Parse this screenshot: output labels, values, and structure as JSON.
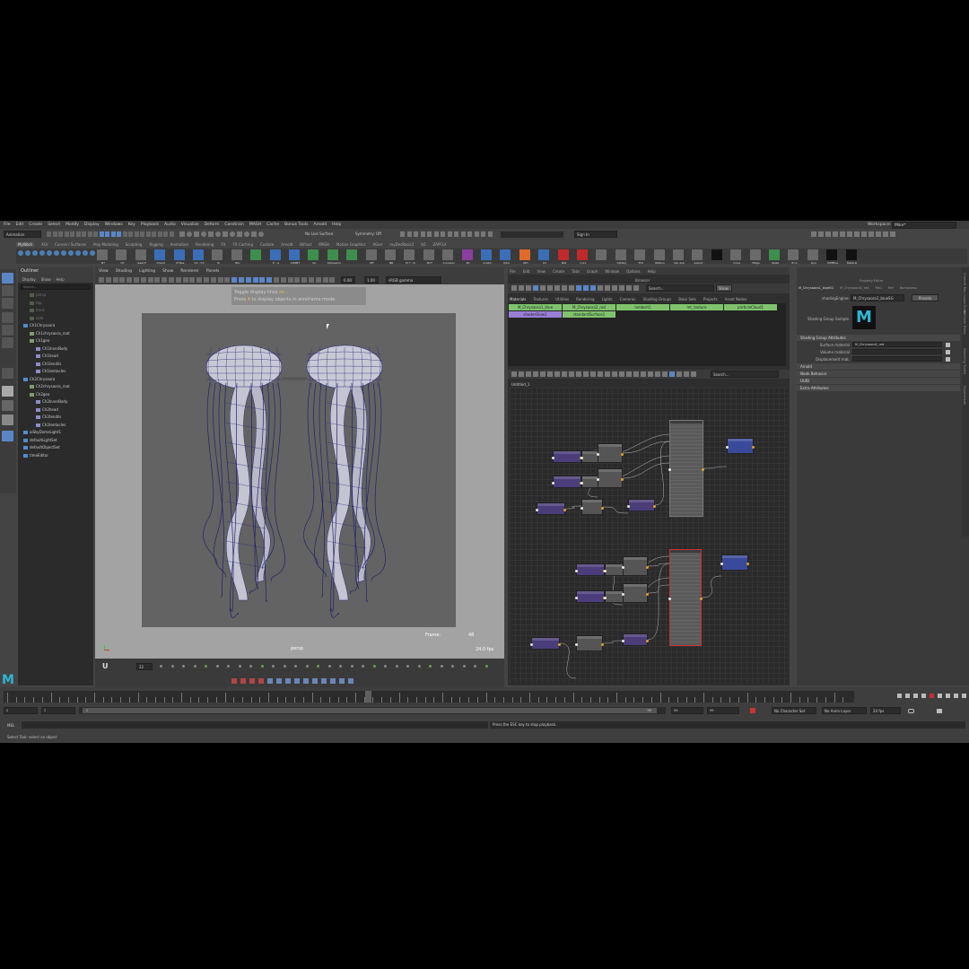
{
  "menu": {
    "items": [
      "File",
      "Edit",
      "Create",
      "Select",
      "Modify",
      "Display",
      "Windows",
      "Key",
      "Playback",
      "Audio",
      "Visualize",
      "Deform",
      "Constrain",
      "MASH",
      "Cache",
      "Bonus Tools",
      "Arnold",
      "Help"
    ],
    "workspace_label": "Workspace:",
    "workspace_value": "Mike*"
  },
  "status": {
    "mode": "Animation",
    "live_surface": "No Live Surface",
    "symmetry": "Symmetry: Off",
    "sign_in": "Sign In"
  },
  "shelf": {
    "tabs": [
      "MyWork",
      "XGI",
      "Curves / Surfaces",
      "Poly Modeling",
      "Sculpting",
      "Rigging",
      "Animation",
      "Rendering",
      "FX",
      "FX Caching",
      "Custom",
      "Arnold",
      "Bifrost",
      "MASH",
      "Motion Graphics",
      "XGen",
      "myDecBasic2",
      "b5",
      "ZAPFLX"
    ],
    "icons": [
      {
        "label": "B7",
        "color": "#6a6a6a"
      },
      {
        "label": "CP",
        "color": "#6a6a6a"
      },
      {
        "label": "reset P",
        "color": "#6a6a6a"
      },
      {
        "label": "Orient",
        "color": "#3a6fb8"
      },
      {
        "label": "CTRLa",
        "color": "#3a6fb8"
      },
      {
        "label": "CV - CV",
        "color": "#3a6fb8"
      },
      {
        "label": "IS",
        "color": "#6a6a6a"
      },
      {
        "label": "RSc",
        "color": "#6a6a6a"
      },
      {
        "label": "",
        "color": "#3e8e4e"
      },
      {
        "label": "P - A",
        "color": "#3a6fb8"
      },
      {
        "label": "CON87",
        "color": "#3a6fb8"
      },
      {
        "label": "bn",
        "color": "#3e8e4e"
      },
      {
        "label": "Sphreams",
        "color": "#3e8e4e"
      },
      {
        "label": "",
        "color": "#3e8e4e"
      },
      {
        "label": "MT",
        "color": "#6a6a6a"
      },
      {
        "label": "NR",
        "color": "#6a6a6a"
      },
      {
        "label": "M T - R",
        "color": "#6a6a6a"
      },
      {
        "label": "MoT",
        "color": "#6a6a6a"
      },
      {
        "label": "CurveLiv",
        "color": "#6a6a6a"
      },
      {
        "label": "2D",
        "color": "#8a3fa0"
      },
      {
        "label": "Graph",
        "color": "#3a6fb8"
      },
      {
        "label": "Qdsl",
        "color": "#3a6fb8"
      },
      {
        "label": "Oth",
        "color": "#e06a2a"
      },
      {
        "label": "bd",
        "color": "#3a6fb8"
      },
      {
        "label": "Bat",
        "color": "#c02a2a"
      },
      {
        "label": "Curv",
        "color": "#c02a2a"
      },
      {
        "label": "",
        "color": "#6a6a6a"
      },
      {
        "label": "CR/Key",
        "color": "#6a6a6a"
      },
      {
        "label": "fmt",
        "color": "#6a6a6a"
      },
      {
        "label": "Ribbon",
        "color": "#6a6a6a"
      },
      {
        "label": "tex dup",
        "color": "#6a6a6a"
      },
      {
        "label": "export",
        "color": "#6a6a6a"
      },
      {
        "label": "",
        "color": "#111111"
      },
      {
        "label": "Cone",
        "color": "#6a6a6a"
      },
      {
        "label": "Mage",
        "color": "#6a6a6a"
      },
      {
        "label": "Spike",
        "color": "#3e8e4e"
      },
      {
        "label": "B rd",
        "color": "#6a6a6a"
      },
      {
        "label": "Dyn",
        "color": "#6a6a6a"
      },
      {
        "label": "OVERLA",
        "color": "#111111"
      },
      {
        "label": "Materal",
        "color": "#111111"
      }
    ]
  },
  "outliner": {
    "title": "Outliner",
    "menu": [
      "Display",
      "Show",
      "Help"
    ],
    "search_placeholder": "Search...",
    "items": [
      {
        "indent": 1,
        "label": "persp",
        "dim": true
      },
      {
        "indent": 1,
        "label": "top",
        "dim": true
      },
      {
        "indent": 1,
        "label": "front",
        "dim": true
      },
      {
        "indent": 1,
        "label": "side",
        "dim": true
      },
      {
        "indent": 0,
        "label": "Ch1Chrysaora",
        "dim": false
      },
      {
        "indent": 1,
        "label": "Ch1chrysaora_root",
        "dim": false
      },
      {
        "indent": 1,
        "label": "Ch1geo",
        "dim": false
      },
      {
        "indent": 2,
        "label": "Ch1InnerBody",
        "dim": false
      },
      {
        "indent": 2,
        "label": "Ch1head",
        "dim": false
      },
      {
        "indent": 2,
        "label": "Ch1tendils",
        "dim": false
      },
      {
        "indent": 2,
        "label": "Ch1tentacles",
        "dim": false
      },
      {
        "indent": 0,
        "label": "Ch2Chrysaora",
        "dim": false
      },
      {
        "indent": 1,
        "label": "Ch2chrysaora_root",
        "dim": false
      },
      {
        "indent": 1,
        "label": "Ch2geo",
        "dim": false
      },
      {
        "indent": 2,
        "label": "Ch2InnerBody",
        "dim": false
      },
      {
        "indent": 2,
        "label": "Ch2head",
        "dim": false
      },
      {
        "indent": 2,
        "label": "Ch2tendils",
        "dim": false
      },
      {
        "indent": 2,
        "label": "Ch2tentacles",
        "dim": false
      },
      {
        "indent": 0,
        "label": "aiSkyDomeLight1",
        "dim": false
      },
      {
        "indent": 0,
        "label": "defaultLightSet",
        "dim": false
      },
      {
        "indent": 0,
        "label": "defaultObjectSet",
        "dim": false
      },
      {
        "indent": 0,
        "label": "timeEditor",
        "dim": false
      }
    ]
  },
  "viewport": {
    "menu": [
      "View",
      "Shading",
      "Lighting",
      "Show",
      "Renderer",
      "Panels"
    ],
    "hud_line1_pre": "Toggle display lines ",
    "hud_line1_on": "on",
    "hud_line1_post": " .",
    "hud_line2_pre": "Press ",
    "hud_line2_key": "4",
    "hud_line2_post": " to display objects in wireframe mode.",
    "value_a": "0.00",
    "value_b": "1.00",
    "colorspace": "sRGB gamma",
    "frame_label": "Frame:",
    "frame_value": "48",
    "camera": "persp",
    "fps": "24.0 fps"
  },
  "playback": {
    "current_frame": "22"
  },
  "hypershade": {
    "menu": [
      "File",
      "Edit",
      "View",
      "Create",
      "Tabs",
      "Graph",
      "Window",
      "Options",
      "Help"
    ],
    "browser_title": "Browser",
    "search_placeholder": "Search...",
    "show_label": "Show",
    "tabs": [
      "Materials",
      "Textures",
      "Utilities",
      "Rendering",
      "Lights",
      "Cameras",
      "Shading Groups",
      "Bake Sets",
      "Projects",
      "Asset Nodes"
    ],
    "materials_row1": [
      "M_Chrysaora1_blue",
      "M_Chrysaora2_red",
      "lambert1",
      "mt_texture",
      "particleCloud1"
    ],
    "materials_row2": [
      "shaderGlow1",
      "standardSurface1"
    ],
    "graph_tab": "Untitled_1",
    "graph_search": "Search..."
  },
  "attribute_editor": {
    "title": "Property Editor",
    "tabs": [
      "M_Chrysaora1_blueSG",
      "M_Chrysaora1_red",
      "file1",
      "Ref",
      "Bumpiness"
    ],
    "node_label": "shadingEngine:",
    "node_value": "M_Chrysaora1_blueSG",
    "presets": "Presets",
    "sample_label": "Shading Group Sample",
    "sample_logo": "M",
    "sections": {
      "sga": "Shading Group Attributes",
      "arnold": "Arnold",
      "node_behavior": "Node Behavior",
      "uuid": "UUID",
      "extra": "Extra Attributes"
    },
    "fields": [
      {
        "label": "Surface material",
        "value": "M_Chrysaora2_red"
      },
      {
        "label": "Volume material",
        "value": ""
      },
      {
        "label": "Displacement mat.",
        "value": ""
      }
    ],
    "side_tabs": [
      "Channel Box / Layer Editor",
      "Attribute Editor",
      "Modelling Toolkit",
      "Hypershade"
    ]
  },
  "bottom": {
    "range_start": "2",
    "range_start2": "2",
    "range_inner": "2",
    "range_inner_end": "99",
    "range_end": "99",
    "range_end2": "99",
    "character_set": "No Character Set",
    "anim_layer": "No Anim Layer",
    "fps": "24 fps",
    "mel_label": "MEL",
    "message": "Press the ESC key to stop playback.",
    "help_line": "Select Tool: select an object"
  },
  "logo": "M"
}
